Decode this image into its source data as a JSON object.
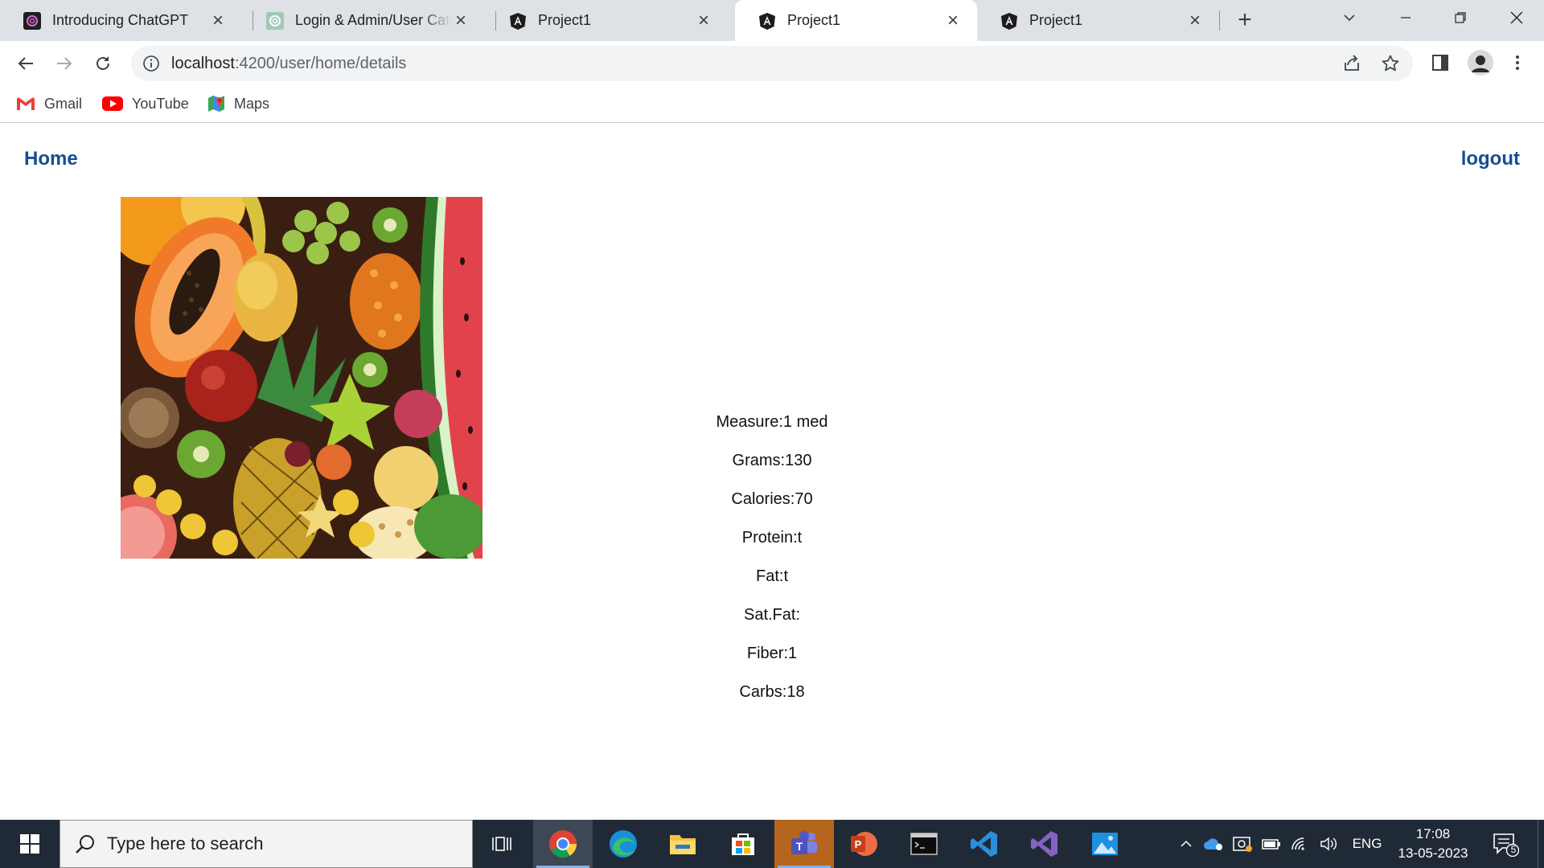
{
  "browser": {
    "tabs": [
      {
        "title": "Introducing ChatGPT",
        "icon": "chatgpt-icon",
        "active": false
      },
      {
        "title": "Login & Admin/User Cate",
        "icon": "chatgpt-icon",
        "active": false
      },
      {
        "title": "Project1",
        "icon": "angular-icon",
        "active": false
      },
      {
        "title": "Project1",
        "icon": "angular-icon",
        "active": true
      },
      {
        "title": "Project1",
        "icon": "angular-icon",
        "active": false
      }
    ],
    "url_host": "localhost",
    "url_path": ":4200/user/home/details",
    "bookmarks": [
      {
        "label": "Gmail",
        "icon": "gmail-icon"
      },
      {
        "label": "YouTube",
        "icon": "youtube-icon"
      },
      {
        "label": "Maps",
        "icon": "maps-icon"
      }
    ]
  },
  "page": {
    "nav": {
      "home": "Home",
      "logout": "logout"
    },
    "image_alt_subject": "assorted tropical fruits",
    "details": [
      "Measure:1 med",
      "Grams:130",
      "Calories:70",
      "Protein:t",
      "Fat:t",
      "Sat.Fat:",
      "Fiber:1",
      "Carbs:18"
    ],
    "link_color": "#164e8f"
  },
  "taskbar": {
    "search_placeholder": "Type here to search",
    "language": "ENG",
    "time": "17:08",
    "date": "13-05-2023",
    "notification_count": "5"
  }
}
